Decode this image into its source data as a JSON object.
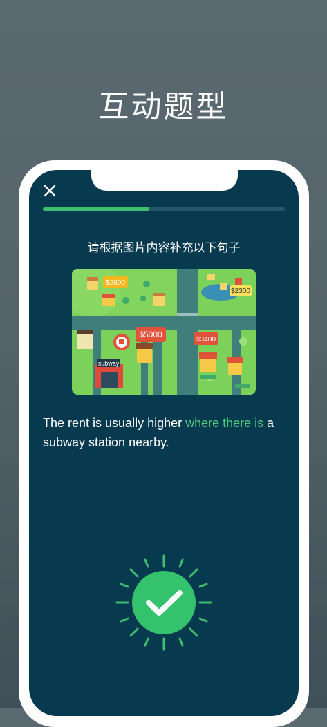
{
  "headline": "互动题型",
  "quiz": {
    "progress": 0.44,
    "instruction": "请根据图片内容补充以下句子",
    "sentence_before": "The rent is usually higher ",
    "answer": "where there is",
    "sentence_after": " a subway station nearby."
  },
  "map": {
    "price_labels": [
      "$2800",
      "$2300",
      "$5000",
      "$3400"
    ],
    "station_sign": "subway"
  },
  "colors": {
    "screen_bg": "#073a4f",
    "accent_green": "#3fbf6e",
    "map_grass": "#7bd159",
    "map_road": "#3f7e7b"
  },
  "icons": {
    "close": "close-icon",
    "result": "check-circle-icon"
  }
}
